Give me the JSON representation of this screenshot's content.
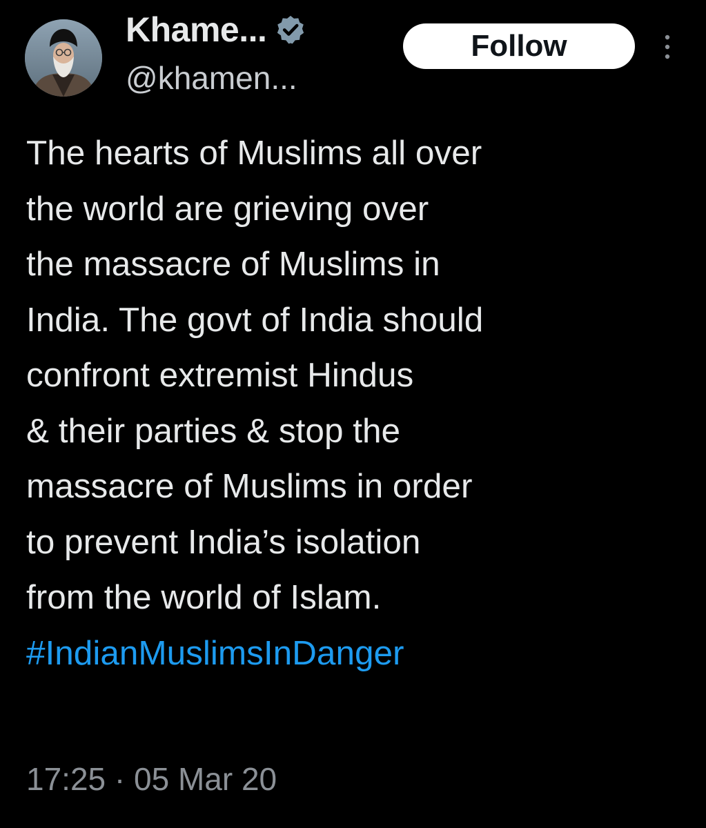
{
  "author": {
    "display_name": "Khame...",
    "handle": "@khamen...",
    "verified_badge_icon": "verified-badge-icon",
    "verified_badge_color": "#829aab"
  },
  "actions": {
    "follow_label": "Follow",
    "more_icon": "more-vertical-icon"
  },
  "tweet": {
    "lines": [
      "The hearts of Muslims all over",
      "the world are grieving over",
      "the massacre of Muslims in",
      "India. The govt of India should",
      "confront extremist Hindus",
      "& their parties & stop the",
      "massacre of Muslims in order",
      "to prevent India’s isolation",
      "from the world of Islam."
    ],
    "hashtag": "#IndianMuslimsInDanger",
    "timestamp": "17:25 · 05 Mar 20"
  },
  "colors": {
    "background": "#000000",
    "text": "#e7e9ea",
    "link": "#1d9bf0",
    "secondary": "#8b9096"
  }
}
